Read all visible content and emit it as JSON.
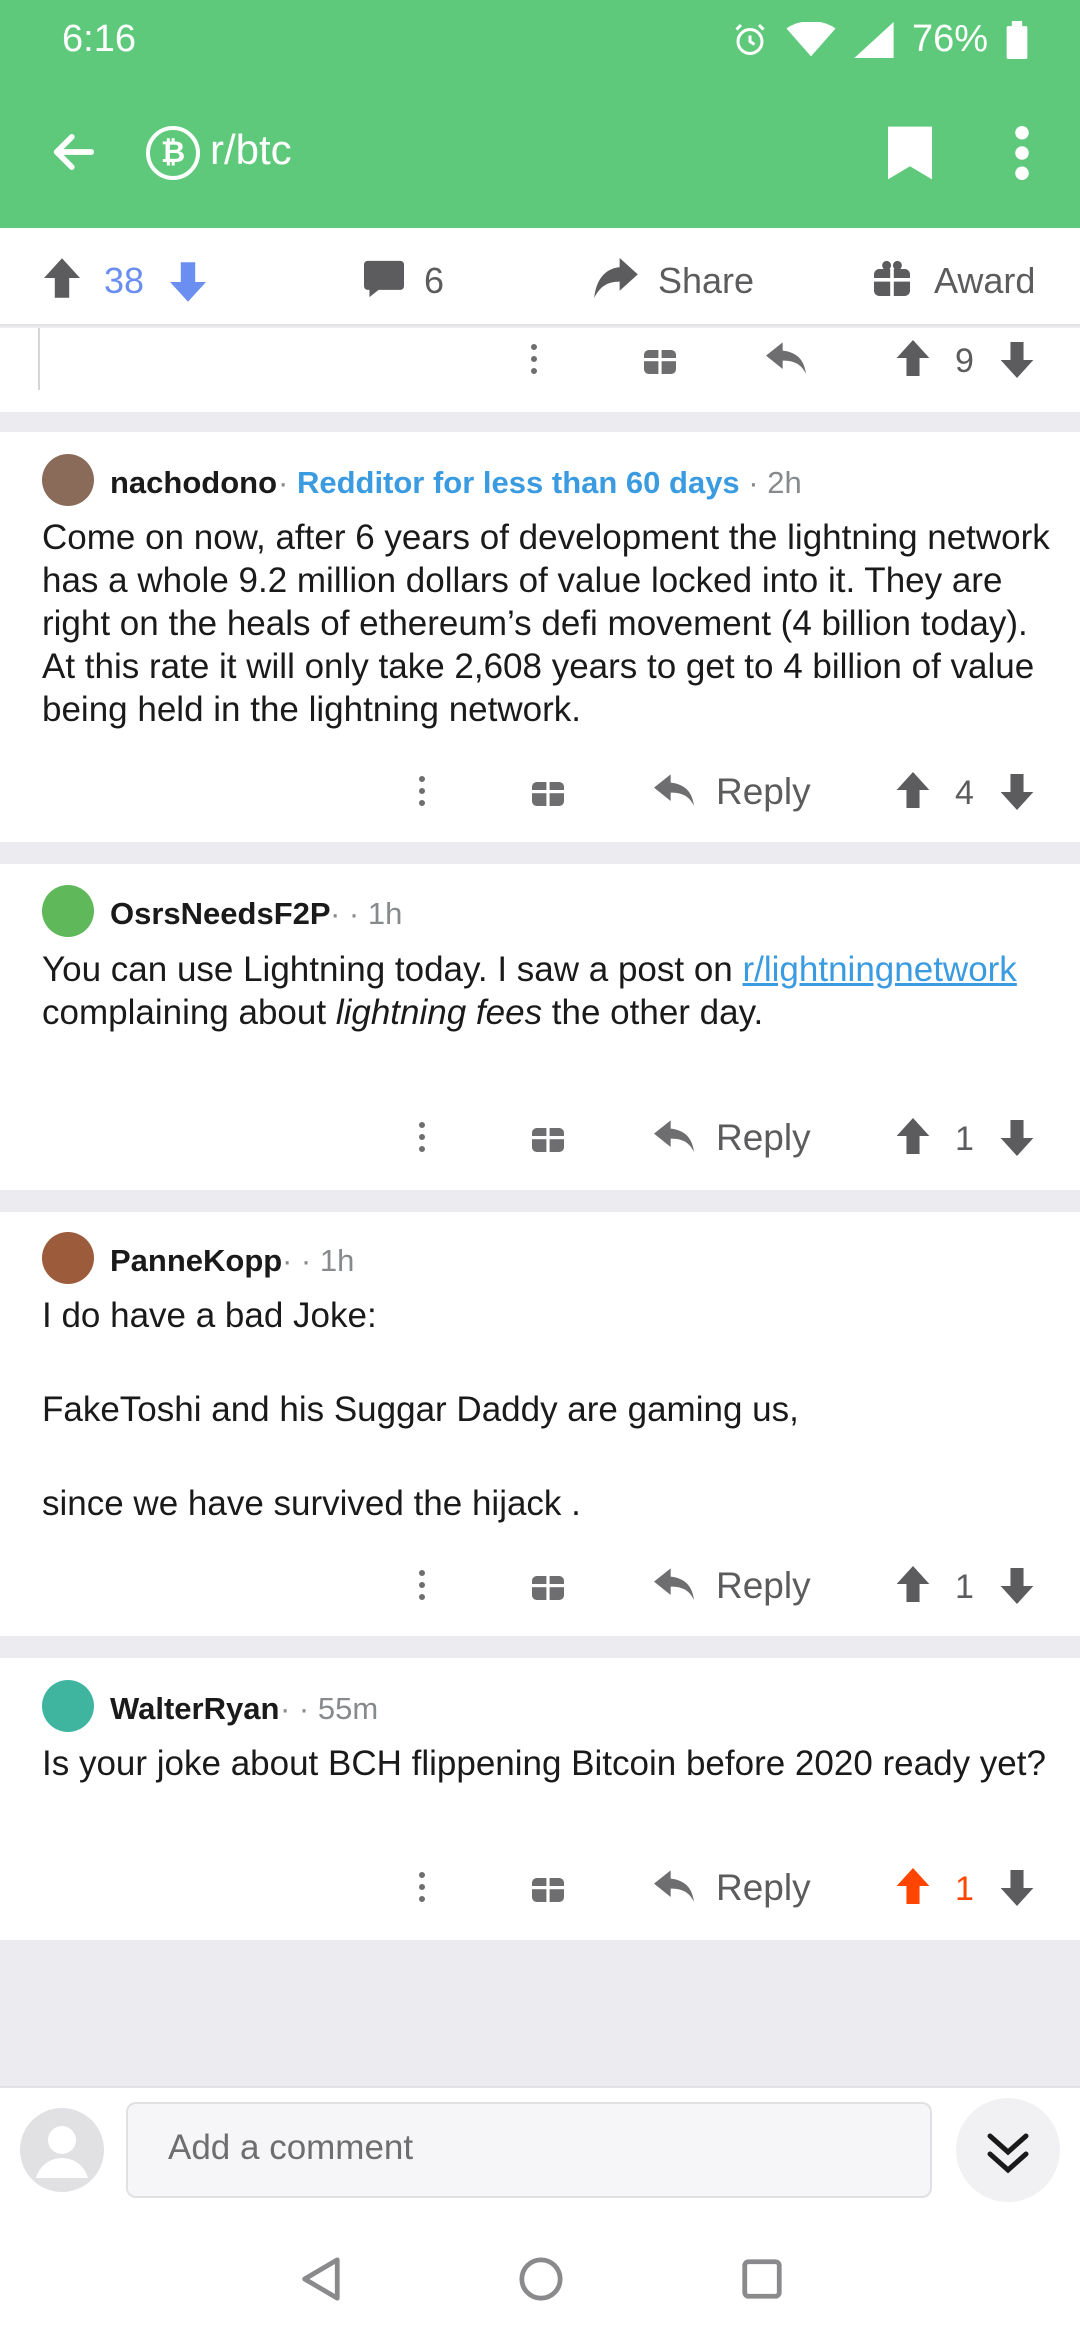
{
  "status": {
    "time": "6:16",
    "battery": "76%"
  },
  "toolbar": {
    "title": "r/btc",
    "sub_icon_letter": "₿"
  },
  "post_actions": {
    "upvotes": "38",
    "comments": "6",
    "share": "Share",
    "award": "Award"
  },
  "partial_comment": {
    "votes": "9"
  },
  "comments": [
    {
      "author": "nachodono",
      "flair": "Redditor for less than 60 days",
      "time": "2h",
      "body": "Come on now, after 6 years of development the lightning network has a whole 9.2 million dollars of value locked into it. They are right on the heals of ethereum’s defi movement (4 billion today). At this rate it will only take 2,608 years to get to 4 billion of value being held in the lightning network.",
      "reply": "Reply",
      "votes": "4"
    },
    {
      "author": "OsrsNeedsF2P",
      "time": "1h",
      "body_pre": "You can use Lightning today. I saw a post on ",
      "body_link": "r/lightningnetwork",
      "body_mid": " complaining about ",
      "body_em": "lightning fees",
      "body_post": " the other day.",
      "reply": "Reply",
      "votes": "1"
    },
    {
      "author": "PanneKopp",
      "time": "1h",
      "body_lines": [
        "I do have a bad Joke:",
        "FakeToshi and his Suggar Daddy are gaming us,",
        "since we have survived the hijack ."
      ],
      "reply": "Reply",
      "votes": "1"
    },
    {
      "author": "WalterRyan",
      "time": "55m",
      "body": "Is your joke about BCH flippening Bitcoin before 2020 ready yet?",
      "reply": "Reply",
      "votes": "1"
    }
  ],
  "composer": {
    "placeholder": "Add a comment"
  },
  "colors": {
    "header": "#5fc97b",
    "link": "#3a9be0",
    "upvoted": "#ff4500",
    "vote_blue": "#6a8ff0"
  }
}
